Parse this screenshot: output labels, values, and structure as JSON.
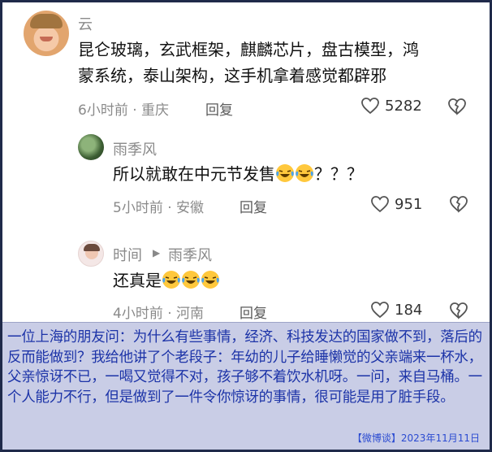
{
  "comments": [
    {
      "user": "云",
      "text_line1": "昆仑玻璃，玄武框架，麒麟芯片，盘古模型，鸿",
      "text_line2": "蒙系统，泰山架构，这手机拿着感觉都辟邪",
      "time_location": "6小时前 · 重庆",
      "reply_label": "回复",
      "likes": "5282"
    },
    {
      "user": "雨季风",
      "text_before": "所以就敢在中元节发售",
      "text_after": "？？？",
      "emoji_count": 2,
      "time_location": "5小时前 · 安徽",
      "reply_label": "回复",
      "likes": "951"
    },
    {
      "user": "时间",
      "reply_to": "雨季风",
      "text_before": "还真是",
      "emoji_count": 3,
      "time_location": "4小时前 · 河南",
      "reply_label": "回复",
      "likes": "184"
    }
  ],
  "caption": "一位上海的朋友问：为什么有些事情，经济、科技发达的国家做不到，落后的反而能做到？我给他讲了个老段子：年幼的儿子给睡懒觉的父亲端来一杯水，父亲惊讶不已，一喝又觉得不对，孩子够不着饮水机呀。一问，来自马桶。一个人能力不行，但是做到了一件令你惊讶的事情，很可能是用了脏手段。",
  "footer": "【微博谈】2023年11月11日",
  "colors": {
    "caption_bg": "#c9cde6",
    "caption_text": "#1d34a8",
    "footer_text": "#2b4bd1",
    "frame": "#1f2a4a"
  },
  "icons": [
    "heart-outline-icon",
    "broken-heart-icon",
    "laughing-crying-emoji",
    "reply-arrow-icon"
  ]
}
